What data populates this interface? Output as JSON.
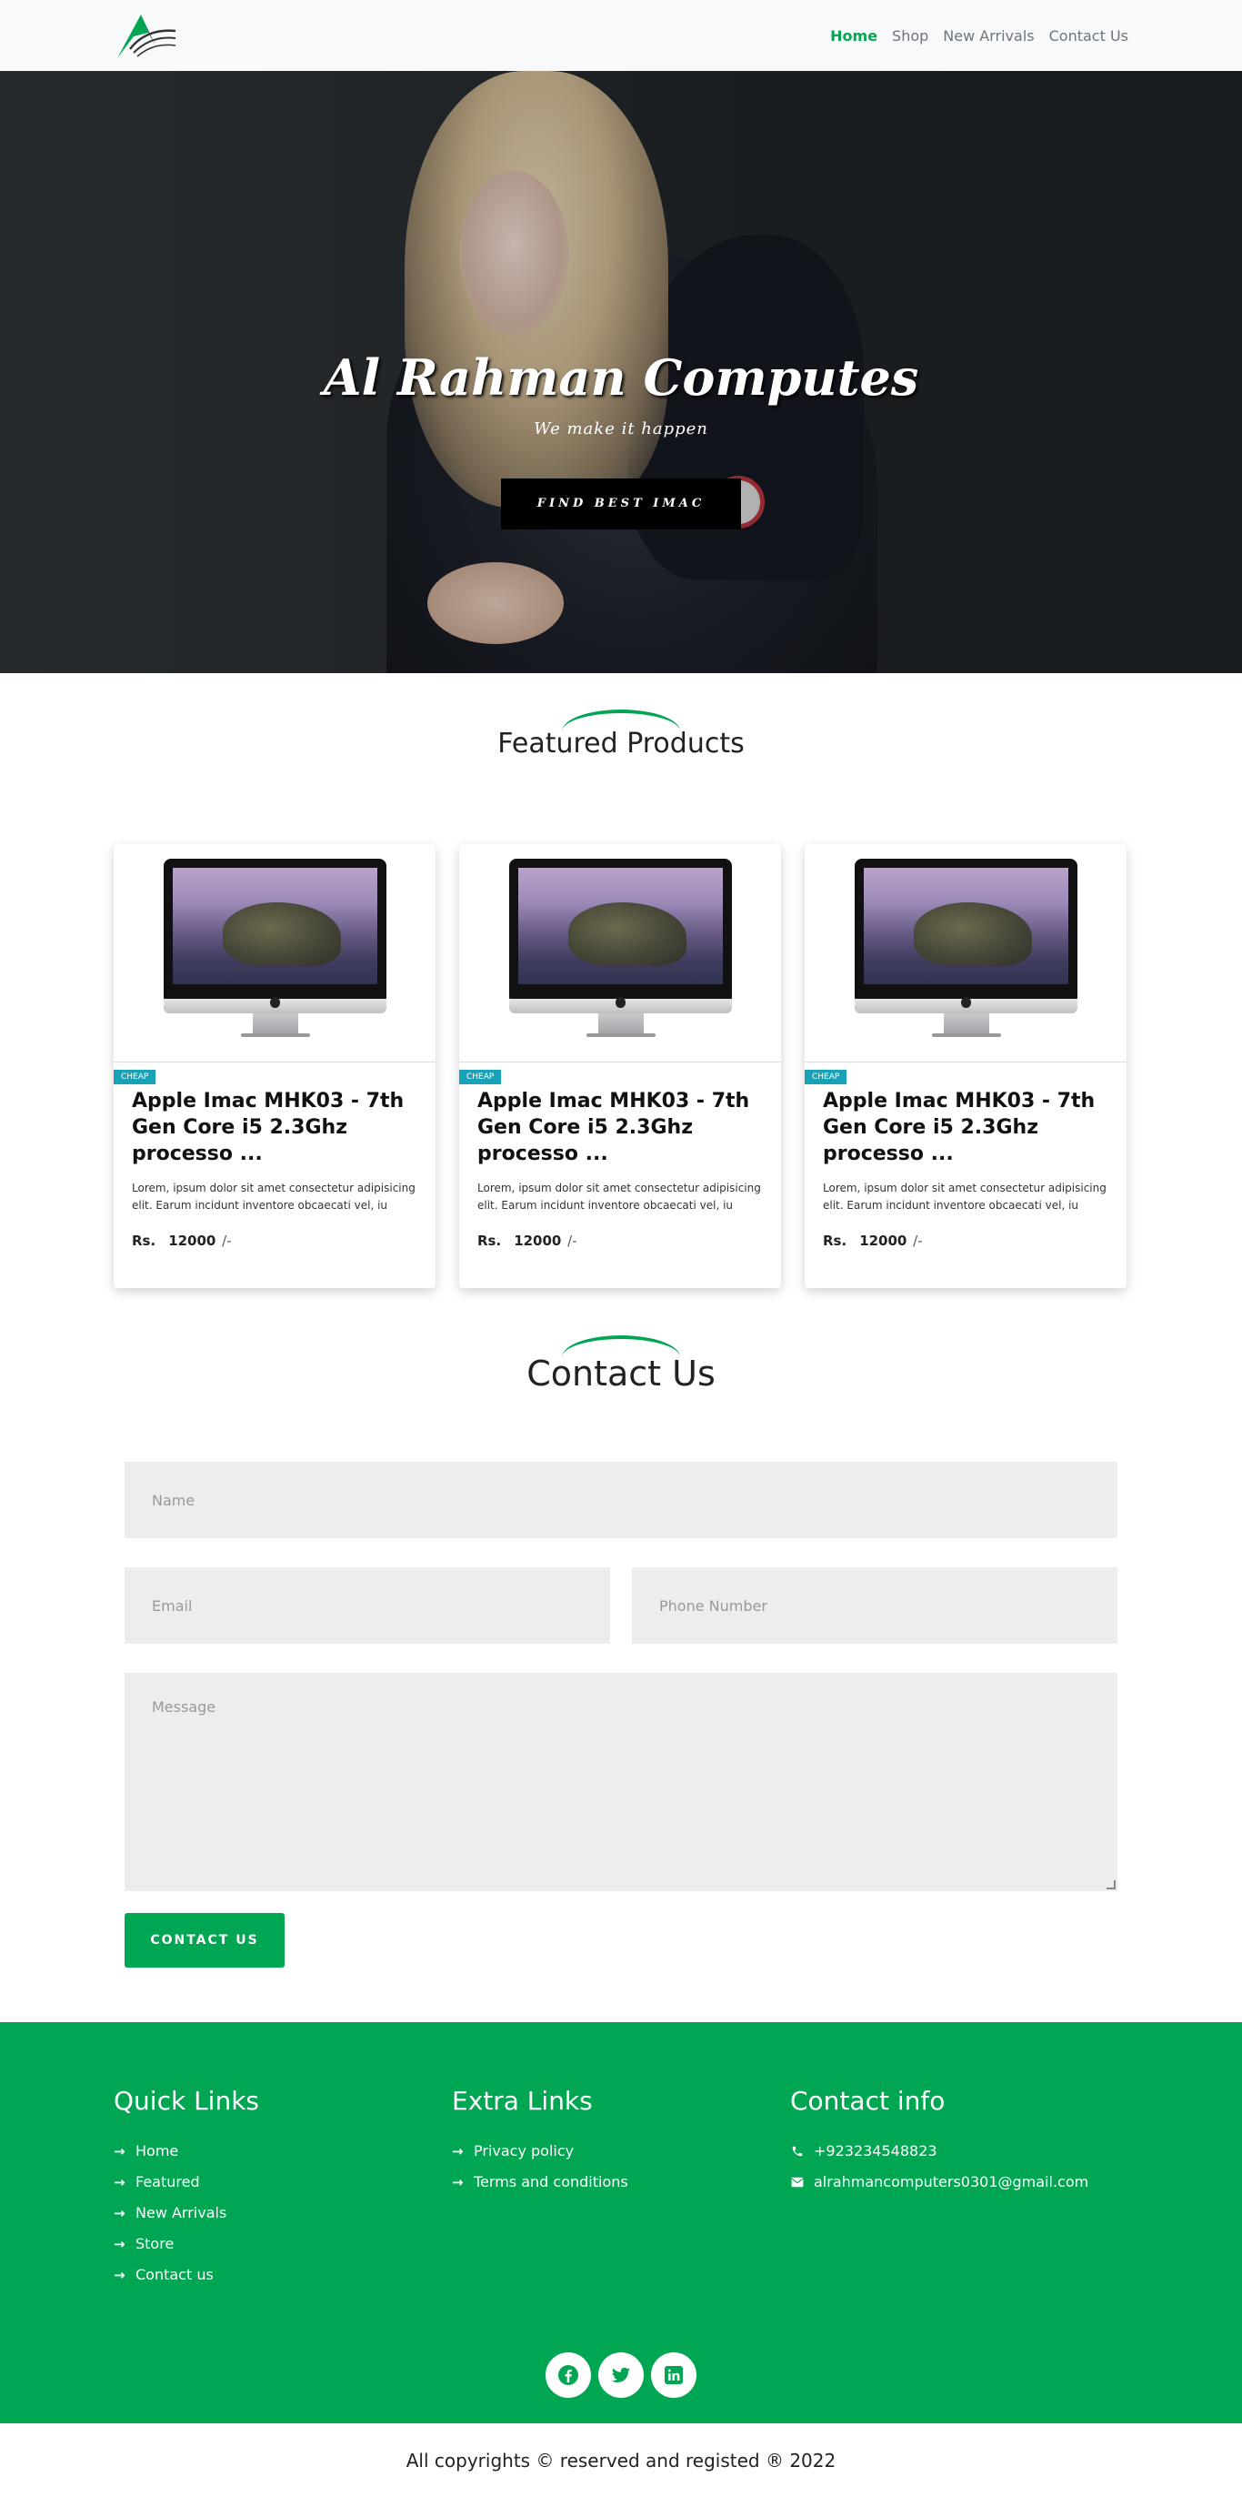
{
  "nav": {
    "links": [
      "Home",
      "Shop",
      "New Arrivals",
      "Contact Us"
    ],
    "active_index": 0,
    "logo_icon": "brand-logo-a-icon"
  },
  "hero": {
    "title": "Al Rahman Computes",
    "subtitle": "We make it happen",
    "button_label": "FIND BEST IMAC"
  },
  "featured": {
    "heading": "Featured Products",
    "products": [
      {
        "badge": "CHEAP",
        "title": "Apple Imac MHK03 - 7th Gen Core i5 2.3Ghz processo ...",
        "description": "Lorem, ipsum dolor sit amet consectetur adipisicing elit. Earum incidunt inventore obcaecati vel, iu",
        "price_label": "Rs.",
        "price": "12000",
        "price_suffix": "/-"
      },
      {
        "badge": "CHEAP",
        "title": "Apple Imac MHK03 - 7th Gen Core i5 2.3Ghz processo ...",
        "description": "Lorem, ipsum dolor sit amet consectetur adipisicing elit. Earum incidunt inventore obcaecati vel, iu",
        "price_label": "Rs.",
        "price": "12000",
        "price_suffix": "/-"
      },
      {
        "badge": "CHEAP",
        "title": "Apple Imac MHK03 - 7th Gen Core i5 2.3Ghz processo ...",
        "description": "Lorem, ipsum dolor sit amet consectetur adipisicing elit. Earum incidunt inventore obcaecati vel, iu",
        "price_label": "Rs.",
        "price": "12000",
        "price_suffix": "/-"
      }
    ]
  },
  "contact": {
    "heading": "Contact Us",
    "name_placeholder": "Name",
    "email_placeholder": "Email",
    "phone_placeholder": "Phone Number",
    "message_placeholder": "Message",
    "submit_label": "CONTACT US"
  },
  "footer": {
    "quick_links": {
      "heading": "Quick Links",
      "items": [
        "Home",
        "Featured",
        "New Arrivals",
        "Store",
        "Contact us"
      ]
    },
    "extra_links": {
      "heading": "Extra Links",
      "items": [
        "Privacy policy",
        "Terms and conditions"
      ]
    },
    "contact_info": {
      "heading": "Contact info",
      "phone": "+923234548823",
      "email": "alrahmancomputers0301@gmail.com"
    },
    "socials": [
      "facebook-icon",
      "twitter-icon",
      "linkedin-icon"
    ],
    "copyright": "All copyrights © reserved and registed ® 2022"
  },
  "colors": {
    "brand_green": "#00a651",
    "badge_blue": "#17a2b8",
    "nav_bg": "#f8f9fa",
    "field_bg": "#ededed"
  }
}
